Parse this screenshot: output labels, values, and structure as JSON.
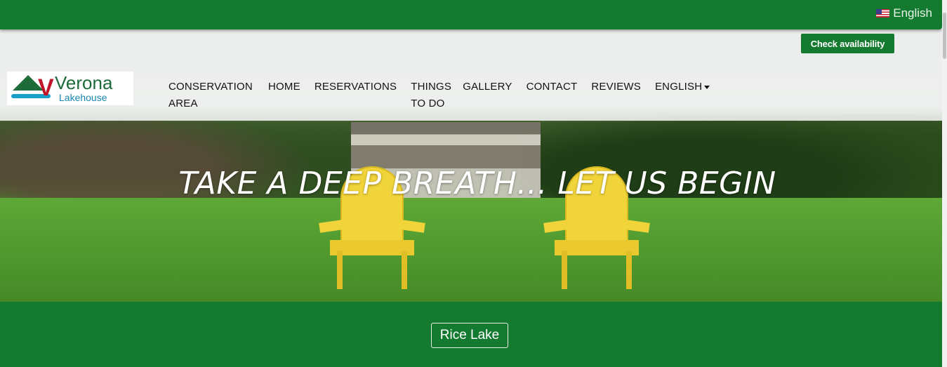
{
  "topbar": {
    "language_label": "English",
    "flag_icon": "us-flag-icon",
    "accent": "#147a30"
  },
  "header": {
    "logo": {
      "title": "Verona",
      "subtitle": "Lakehouse"
    },
    "check_availability_label": "Check availability",
    "nav": {
      "conservation_line1": "CONSERVATION",
      "conservation_line2": "AREA",
      "home": "HOME",
      "reservations": "RESERVATIONS",
      "things_line1": "THINGS",
      "things_line2": "TO DO",
      "gallery": "GALLERY",
      "contact": "CONTACT",
      "reviews": "REVIEWS",
      "language": "ENGLISH"
    }
  },
  "hero": {
    "headline": "TAKE A DEEP BREATH... LET US BEGIN"
  },
  "footer_band": {
    "location_button": "Rice Lake"
  }
}
